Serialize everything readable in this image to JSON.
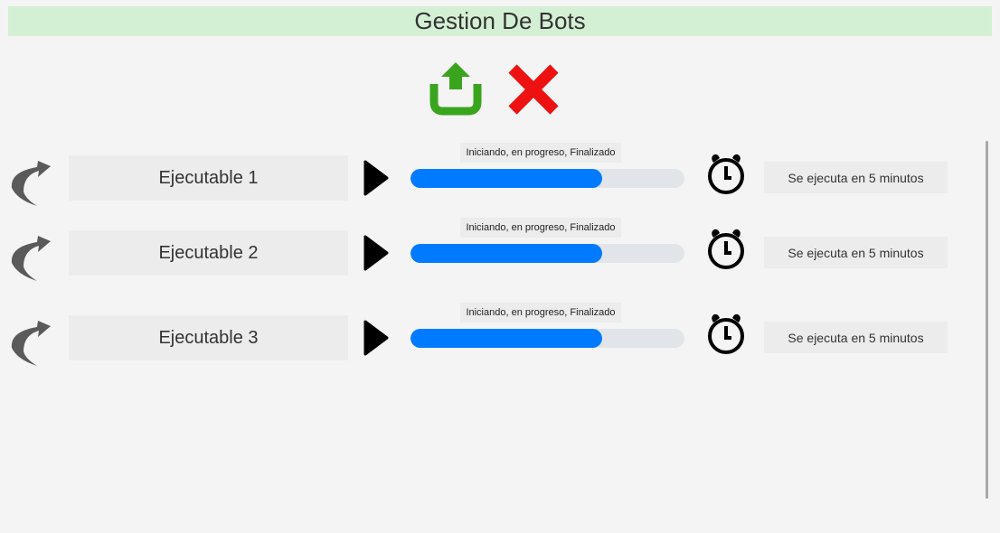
{
  "header": {
    "title": "Gestion De Bots"
  },
  "toolbar": {
    "upload_icon": "upload-icon",
    "close_icon": "close-icon"
  },
  "colors": {
    "header_bg": "#d4f0d4",
    "progress": "#007bff",
    "upload": "#3aa41e",
    "close": "#ee1111"
  },
  "bots": [
    {
      "name": "Ejecutable 1",
      "status": "Iniciando, en progreso, Finalizado",
      "progress": 0.7,
      "schedule": "Se ejecuta en 5 minutos"
    },
    {
      "name": "Ejecutable 2",
      "status": "Iniciando, en progreso, Finalizado",
      "progress": 0.7,
      "schedule": "Se ejecuta en 5 minutos"
    },
    {
      "name": "Ejecutable 3",
      "status": "Iniciando, en progreso, Finalizado",
      "progress": 0.7,
      "schedule": "Se ejecuta en 5 minutos"
    }
  ]
}
